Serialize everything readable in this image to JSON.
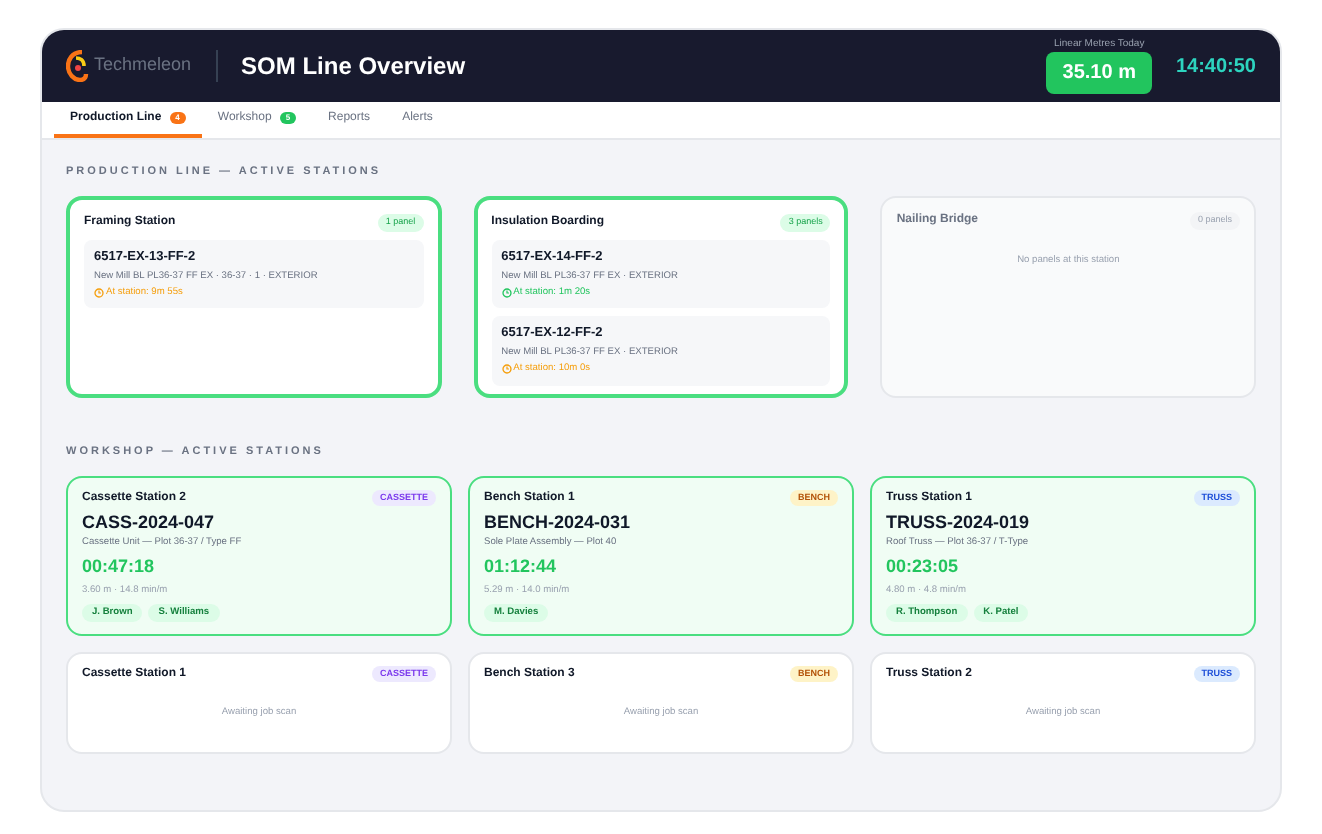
{
  "header": {
    "brand": "Techmeleon",
    "title": "SOM Line Overview",
    "metric_label": "Linear Metres Today",
    "metric_value": "35.10 m",
    "clock": "14:40:50"
  },
  "tabs": [
    {
      "label": "Production Line",
      "badge": "4",
      "color": "#f97316",
      "selected": true
    },
    {
      "label": "Workshop",
      "badge": "5",
      "color": "#22c55e",
      "selected": false
    },
    {
      "label": "Reports",
      "selected": false
    },
    {
      "label": "Alerts",
      "selected": false
    }
  ],
  "production": {
    "heading": "PRODUCTION LINE — ACTIVE STATIONS",
    "stations": [
      {
        "name": "Framing Station",
        "count": "1 panel",
        "active": true,
        "panels": [
          {
            "code": "6517-EX-13-FF-2",
            "desc": "New Mill BL PL36-37 FF EX · 36-37 · 1 · EXTERIOR",
            "time": "At station: 9m 55s",
            "warning": true
          }
        ]
      },
      {
        "name": "Insulation Boarding",
        "count": "3 panels",
        "active": true,
        "panels": [
          {
            "code": "6517-EX-14-FF-2",
            "desc": "New Mill BL PL36-37 FF EX · EXTERIOR",
            "time": "At station: 1m 20s",
            "warning": false
          },
          {
            "code": "6517-EX-12-FF-2",
            "desc": "New Mill BL PL36-37 FF EX · EXTERIOR",
            "time": "At station: 10m 0s",
            "warning": true
          }
        ]
      },
      {
        "name": "Nailing Bridge",
        "count": "0 panels",
        "active": false,
        "empty": "No panels at this station"
      }
    ]
  },
  "workshop": {
    "heading": "WORKSHOP — ACTIVE STATIONS",
    "stations": [
      {
        "name": "Cassette Station 2",
        "kind": "cassette",
        "tag": "CASSETTE",
        "active": true,
        "job": "CASS-2024-047",
        "desc": "Cassette Unit — Plot 36-37 / Type FF",
        "timer": "00:47:18",
        "rate": "3.60 m · 14.8 min/m",
        "workers": [
          "J. Brown",
          "S. Williams"
        ]
      },
      {
        "name": "Bench Station 1",
        "kind": "bench",
        "tag": "BENCH",
        "active": true,
        "job": "BENCH-2024-031",
        "desc": "Sole Plate Assembly — Plot 40",
        "timer": "01:12:44",
        "rate": "5.29 m · 14.0 min/m",
        "workers": [
          "M. Davies"
        ]
      },
      {
        "name": "Truss Station 1",
        "kind": "truss",
        "tag": "TRUSS",
        "active": true,
        "job": "TRUSS-2024-019",
        "desc": "Roof Truss — Plot 36-37 / T-Type",
        "timer": "00:23:05",
        "rate": "4.80 m · 4.8 min/m",
        "workers": [
          "R. Thompson",
          "K. Patel"
        ]
      },
      {
        "name": "Cassette Station 1",
        "kind": "cassette",
        "tag": "CASSETTE",
        "active": false,
        "idle": "Awaiting job scan"
      },
      {
        "name": "Bench Station 3",
        "kind": "bench",
        "tag": "BENCH",
        "active": false,
        "idle": "Awaiting job scan"
      },
      {
        "name": "Truss Station 2",
        "kind": "truss",
        "tag": "TRUSS",
        "active": false,
        "idle": "Awaiting job scan"
      }
    ]
  }
}
